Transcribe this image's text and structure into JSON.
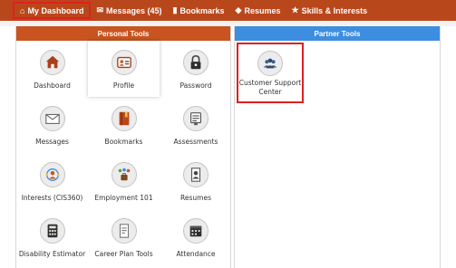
{
  "nav": {
    "dashboard": "My Dashboard",
    "messages": "Messages (45)",
    "bookmarks": "Bookmarks",
    "resumes": "Resumes",
    "skills": "Skills & Interests"
  },
  "personal": {
    "header": "Personal Tools",
    "tools": [
      {
        "label": "Dashboard",
        "icon": "home-icon"
      },
      {
        "label": "Profile",
        "icon": "profile-card-icon"
      },
      {
        "label": "Password",
        "icon": "lock-icon"
      },
      {
        "label": "Messages",
        "icon": "envelope-icon"
      },
      {
        "label": "Bookmarks",
        "icon": "book-icon"
      },
      {
        "label": "Assessments",
        "icon": "monitor-icon"
      },
      {
        "label": "Interests (CIS360)",
        "icon": "interests-icon"
      },
      {
        "label": "Employment 101",
        "icon": "briefcase-people-icon"
      },
      {
        "label": "Resumes",
        "icon": "resume-icon"
      },
      {
        "label": "Disability Estimator",
        "icon": "calculator-icon"
      },
      {
        "label": "Career Plan Tools",
        "icon": "document-icon"
      },
      {
        "label": "Attendance",
        "icon": "calendar-icon"
      }
    ]
  },
  "partner": {
    "header": "Partner Tools",
    "tools": [
      {
        "label": "Customer Support Center",
        "icon": "support-team-icon"
      }
    ]
  },
  "colors": {
    "nav_bg": "#b9471c",
    "personal_header": "#c9541f",
    "partner_header": "#3d8ee0",
    "highlight": "#e02020"
  }
}
